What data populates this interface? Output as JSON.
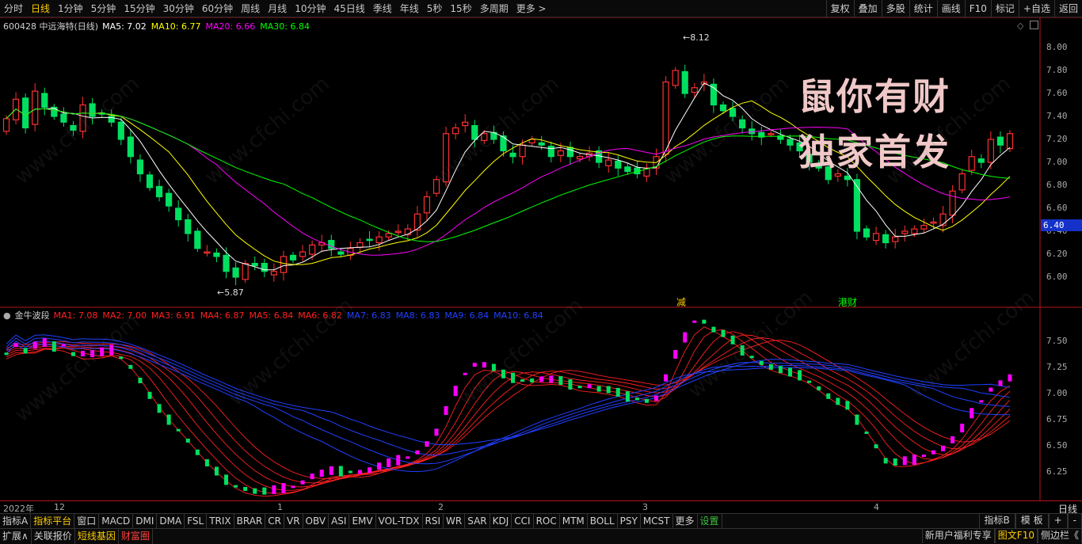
{
  "toolbar": {
    "periods": [
      "分时",
      "日线",
      "1分钟",
      "5分钟",
      "15分钟",
      "30分钟",
      "60分钟",
      "周线",
      "月线",
      "10分钟",
      "45日线",
      "季线",
      "年线",
      "5秒",
      "15秒",
      "多周期",
      "更多 >"
    ],
    "active_period": "日线",
    "tools": [
      "复权",
      "叠加",
      "多股",
      "统计",
      "画线",
      "F10",
      "标记",
      "+自选",
      "返回"
    ]
  },
  "main_chart": {
    "stock_label": "600428 中远海特(日线)",
    "ma_legend": [
      {
        "label": "MA5: 7.02",
        "color": "#ffffff"
      },
      {
        "label": "MA10: 6.77",
        "color": "#ffff00"
      },
      {
        "label": "MA20: 6.66",
        "color": "#ff00ff"
      },
      {
        "label": "MA30: 6.84",
        "color": "#00ff00"
      }
    ],
    "y_ticks": [
      "8.00",
      "7.80",
      "7.60",
      "7.40",
      "7.20",
      "7.00",
      "6.80",
      "6.60",
      "6.40",
      "6.20",
      "6.00"
    ],
    "current_price": "6.40",
    "high_marker": "8.12",
    "low_marker": "5.87",
    "event_tags": [
      {
        "label": "减",
        "color": "#ffcc00"
      },
      {
        "label": "港财",
        "color": "#00ff00"
      }
    ],
    "overlay_line1": "鼠你有财",
    "overlay_line2": "独家首发"
  },
  "sub_chart": {
    "name": "金牛波段",
    "ma_legend": [
      {
        "label": "MA1: 7.08",
        "color": "#ff2020"
      },
      {
        "label": "MA2: 7.00",
        "color": "#ff2020"
      },
      {
        "label": "MA3: 6.91",
        "color": "#ff2020"
      },
      {
        "label": "MA4: 6.87",
        "color": "#ff2020"
      },
      {
        "label": "MA5: 6.84",
        "color": "#ff2020"
      },
      {
        "label": "MA6: 6.82",
        "color": "#ff2020"
      },
      {
        "label": "MA7: 6.83",
        "color": "#2040ff"
      },
      {
        "label": "MA8: 6.83",
        "color": "#2040ff"
      },
      {
        "label": "MA9: 6.84",
        "color": "#2040ff"
      },
      {
        "label": "MA10: 6.84",
        "color": "#2040ff"
      }
    ],
    "y_ticks": [
      "7.50",
      "7.25",
      "7.00",
      "6.75",
      "6.50",
      "6.25"
    ]
  },
  "time_axis": {
    "labels": [
      "2022年",
      "12",
      "1",
      "2",
      "3",
      "4"
    ],
    "button": "日线"
  },
  "indicator_tabs": [
    "指标A",
    "指标平台",
    "窗口",
    "MACD",
    "DMI",
    "DMA",
    "FSL",
    "TRIX",
    "BRAR",
    "CR",
    "VR",
    "OBV",
    "ASI",
    "EMV",
    "VOL-TDX",
    "RSI",
    "WR",
    "SAR",
    "KDJ",
    "CCI",
    "ROC",
    "MTM",
    "BOLL",
    "PSY",
    "MCST",
    "更多",
    "设置"
  ],
  "indicator_right": [
    "指标B",
    "模 板",
    "+",
    "-"
  ],
  "status_bar": {
    "left": [
      {
        "label": "扩展∧",
        "color": "#d0d0d0"
      },
      {
        "label": "关联报价",
        "color": "#d0d0d0"
      },
      {
        "label": "短线基因",
        "color": "#ffcc00"
      },
      {
        "label": "财富圈",
        "color": "#ff4040"
      }
    ],
    "right": [
      {
        "label": "新用户福利专享",
        "color": "#d0d0d0"
      },
      {
        "label": "图文F10",
        "color": "#ffcc00"
      },
      {
        "label": "侧边栏《",
        "color": "#d0d0d0"
      }
    ]
  },
  "watermark": "www.cfchi.com",
  "colors": {
    "up": "#ff3030",
    "down": "#00e060",
    "magenta": "#ff00ff",
    "blue": "#2040ff"
  }
}
